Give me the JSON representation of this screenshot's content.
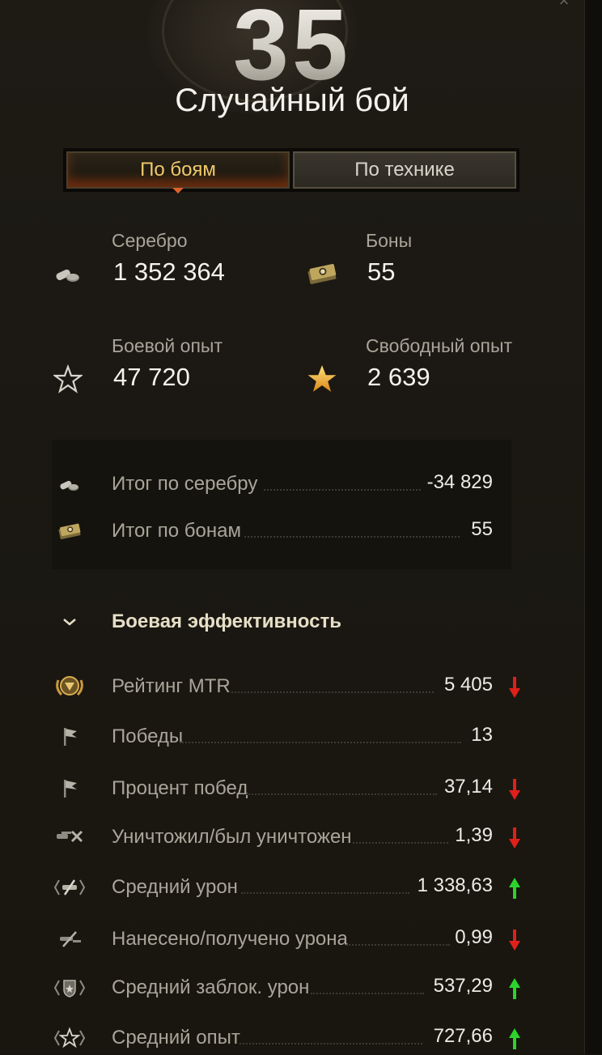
{
  "header": {
    "big_number": "35",
    "battle_type": "Случайный бой"
  },
  "tabs": [
    {
      "label": "По боям",
      "active": true
    },
    {
      "label": "По технике",
      "active": false
    }
  ],
  "stats": {
    "silver": {
      "label": "Серебро",
      "value": "1 352 364",
      "icon": "silver-icon"
    },
    "bonds": {
      "label": "Боны",
      "value": "55",
      "icon": "bonds-icon"
    },
    "battle_xp": {
      "label": "Боевой опыт",
      "value": "47 720",
      "icon": "star-outline-icon"
    },
    "free_xp": {
      "label": "Свободный опыт",
      "value": "2 639",
      "icon": "star-gold-icon"
    }
  },
  "summary": [
    {
      "label": "Итог по серебру",
      "value": "-34 829",
      "icon": "silver-icon"
    },
    {
      "label": "Итог по бонам",
      "value": "55",
      "icon": "bonds-icon"
    }
  ],
  "efficiency": {
    "title": "Боевая эффективность",
    "rows": [
      {
        "label": "Рейтинг MTR",
        "value": "5 405",
        "trend": "down",
        "icon": "mtr-rating-icon"
      },
      {
        "label": "Победы",
        "value": "13",
        "trend": "none",
        "icon": "flag-icon"
      },
      {
        "label": "Процент побед",
        "value": "37,14",
        "trend": "down",
        "icon": "flag-icon"
      },
      {
        "label": "Уничтожил/был уничтожен",
        "value": "1,39",
        "trend": "down",
        "icon": "destroyed-tanks-icon"
      },
      {
        "label": "Средний урон",
        "value": "1 338,63",
        "trend": "up",
        "icon": "damage-icon"
      },
      {
        "label": "Нанесено/получено урона",
        "value": "0,99",
        "trend": "down",
        "icon": "damage-ratio-icon"
      },
      {
        "label": "Средний заблок. урон",
        "value": "537,29",
        "trend": "up",
        "icon": "blocked-damage-icon"
      },
      {
        "label": "Средний опыт",
        "value": "727,66",
        "trend": "up",
        "icon": "avg-xp-icon"
      }
    ]
  },
  "colors": {
    "trend_up": "#2bd42b",
    "trend_down": "#e0201a",
    "tab_active_text": "#f0c96a"
  }
}
